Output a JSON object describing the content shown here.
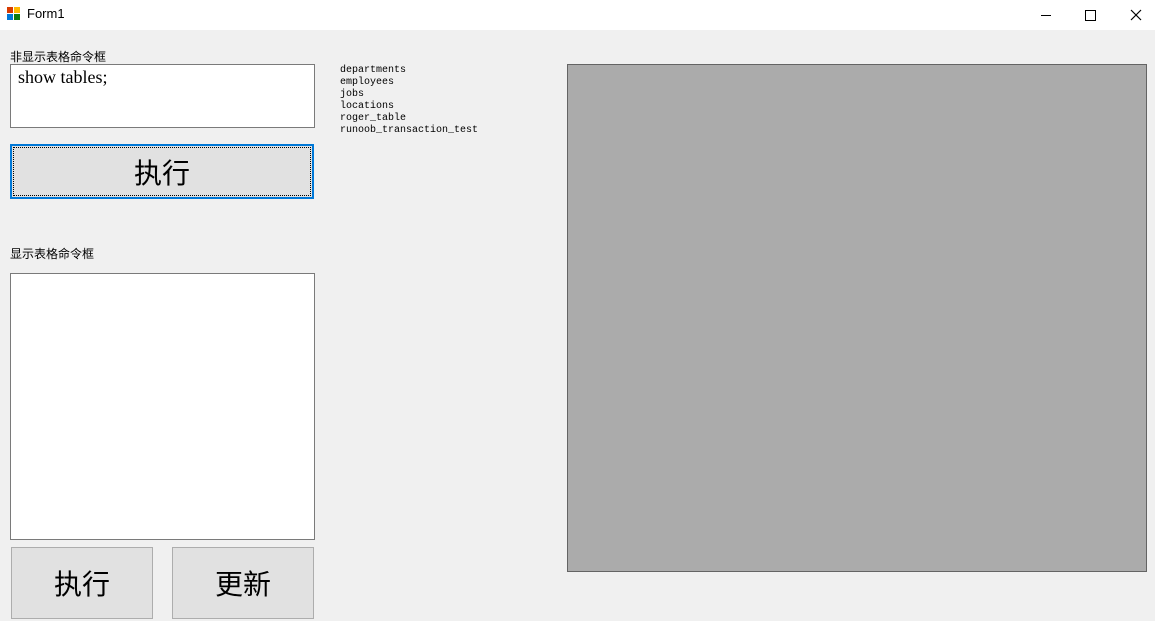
{
  "window": {
    "title": "Form1",
    "icon_colors": [
      "#d83b01",
      "#ffb900",
      "#0078d7",
      "#107c10"
    ]
  },
  "top_section": {
    "label": "非显示表格命令框",
    "command_value": "show tables;",
    "execute_label": "执行"
  },
  "bottom_section": {
    "label": "显示表格命令框",
    "command_value": "",
    "execute_label": "执行",
    "update_label": "更新"
  },
  "results": {
    "tables": [
      "departments",
      "employees",
      "jobs",
      "locations",
      "roger_table",
      "runoob_transaction_test"
    ]
  },
  "data_grid": {
    "background": "#ababab"
  }
}
